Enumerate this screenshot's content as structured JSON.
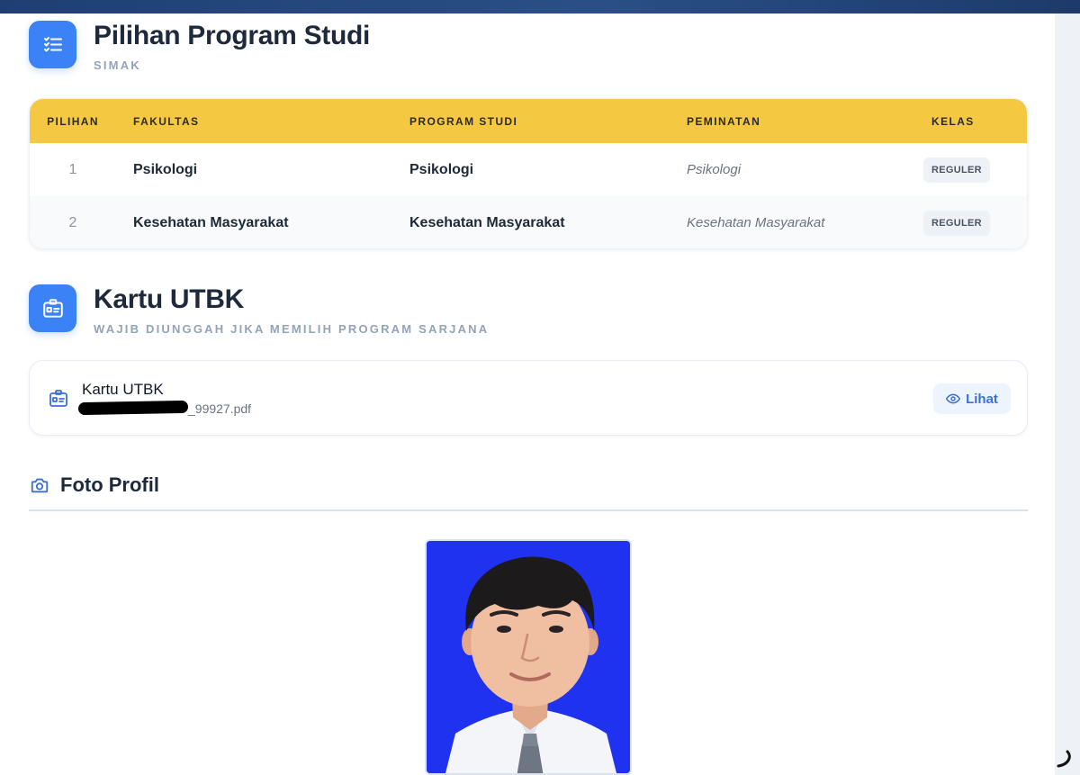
{
  "program_section": {
    "title": "Pilihan Program Studi",
    "subtitle": "SIMAK",
    "icon": "checklist-icon"
  },
  "table": {
    "headers": {
      "pilihan": "PILIHAN",
      "fakultas": "FAKULTAS",
      "program_studi": "PROGRAM STUDI",
      "peminatan": "PEMINATAN",
      "kelas": "KELAS"
    },
    "rows": [
      {
        "no": "1",
        "fakultas": "Psikologi",
        "program_studi": "Psikologi",
        "peminatan": "Psikologi",
        "kelas": "REGULER"
      },
      {
        "no": "2",
        "fakultas": "Kesehatan Masyarakat",
        "program_studi": "Kesehatan Masyarakat",
        "peminatan": "Kesehatan Masyarakat",
        "kelas": "REGULER"
      }
    ]
  },
  "utbk_section": {
    "title": "Kartu UTBK",
    "subtitle": "WAJIB DIUNGGAH JIKA MEMILIH PROGRAM SARJANA",
    "icon": "id-card-icon"
  },
  "file": {
    "name": "Kartu UTBK",
    "filename_visible": "_99927.pdf",
    "view_label": "Lihat"
  },
  "photo_section": {
    "title": "Foto Profil",
    "icon": "camera-icon"
  },
  "colors": {
    "accent": "#3b82f6",
    "table_header": "#f5c842",
    "photo_background": "#1f32f0"
  }
}
